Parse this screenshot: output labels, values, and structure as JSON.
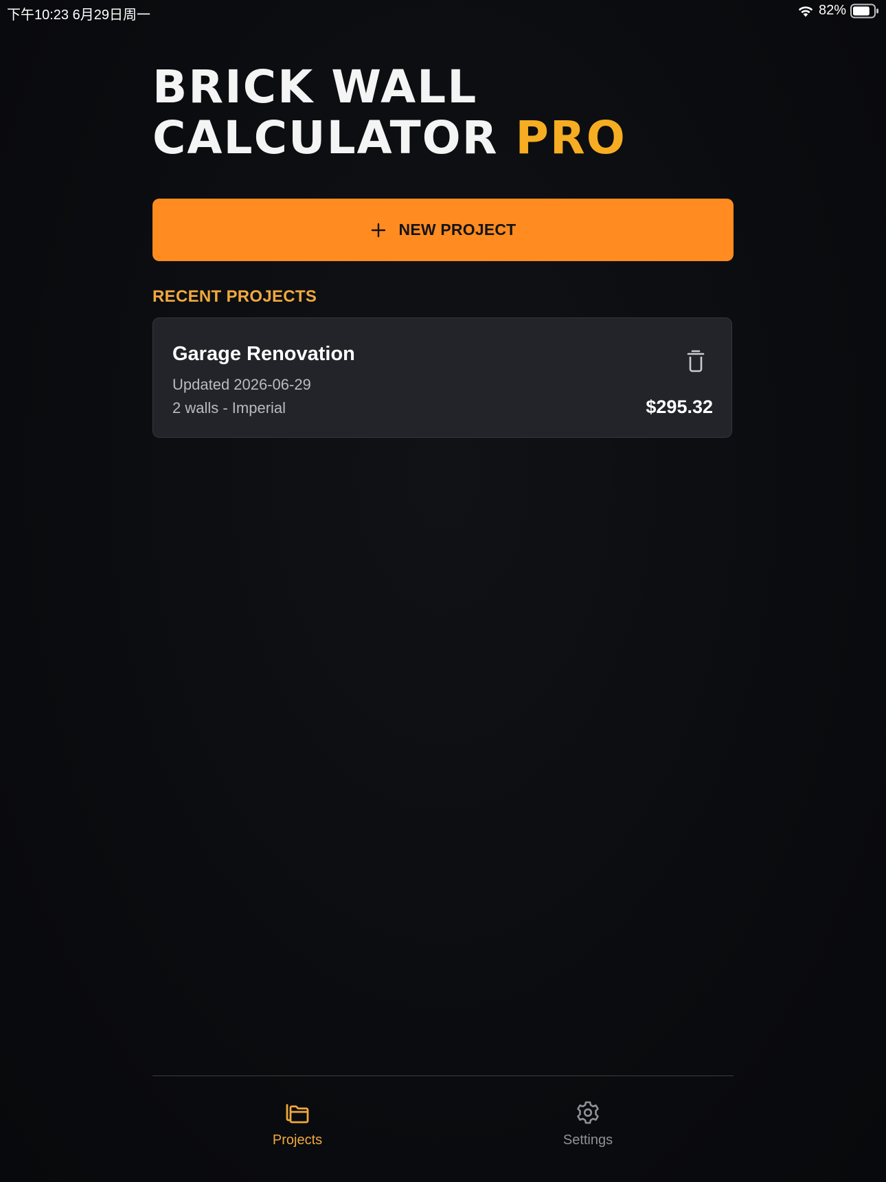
{
  "status_bar": {
    "time_date": "下午10:23   6月29日周一",
    "battery_percent": "82%",
    "battery_level": 0.82,
    "wifi_icon": "wifi-icon",
    "battery_icon": "battery-icon"
  },
  "header": {
    "title_line1": "BRICK WALL",
    "title_line2": "CALCULATOR",
    "title_accent": "PRO",
    "accent_color": "#f6ad22"
  },
  "new_project_button": {
    "label": "NEW PROJECT",
    "icon": "plus-icon",
    "color": "#ff8b21"
  },
  "recent_projects": {
    "heading": "RECENT PROJECTS",
    "items": [
      {
        "name": "Garage Renovation",
        "updated": "Updated 2026-06-29",
        "meta": "2 walls - Imperial",
        "cost": "$295.32",
        "delete_icon": "trash-icon"
      }
    ]
  },
  "tab_bar": {
    "tabs": [
      {
        "label": "Projects",
        "icon": "folder-icon",
        "active": true
      },
      {
        "label": "Settings",
        "icon": "gear-icon",
        "active": false
      }
    ],
    "active_color": "#f0a93e",
    "inactive_color": "#8f9297"
  }
}
